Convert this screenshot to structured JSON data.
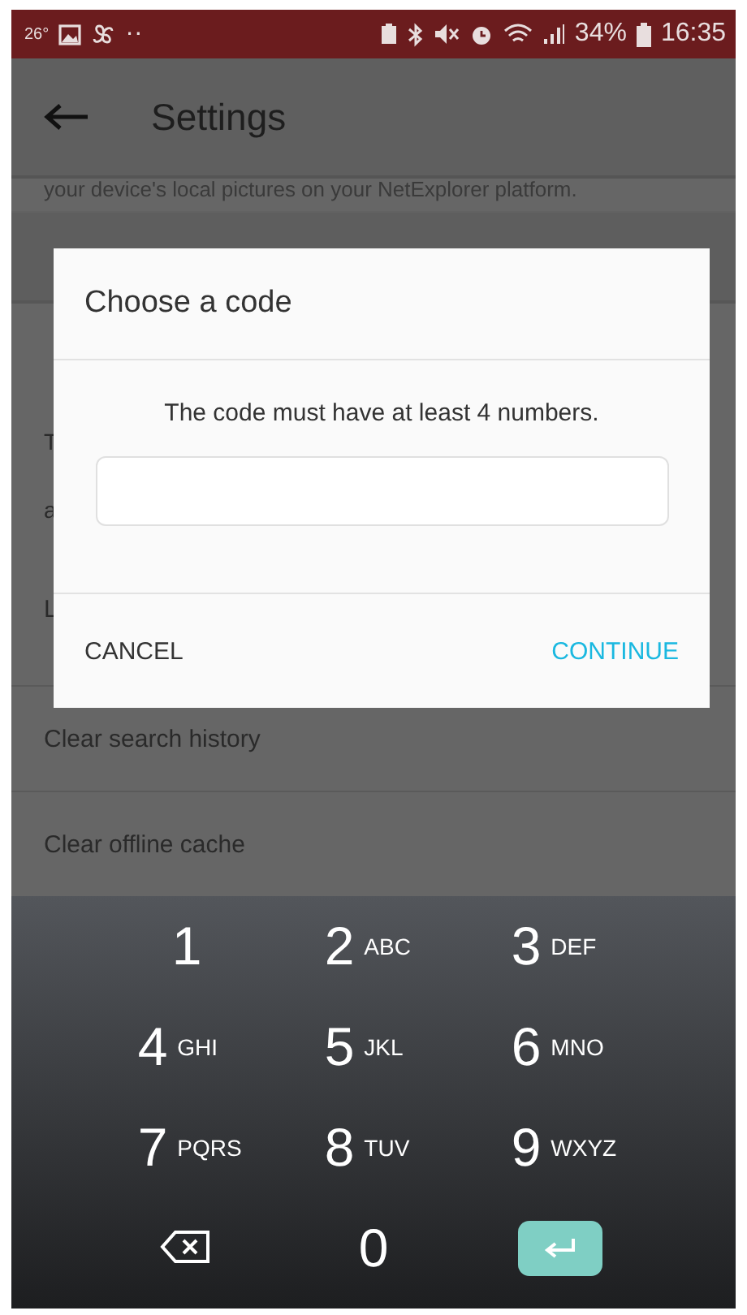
{
  "status_bar": {
    "temperature": "26°",
    "dots": "··",
    "battery_percent": "34%",
    "time": "16:35"
  },
  "app_bar": {
    "title": "Settings"
  },
  "background": {
    "description": "your device's local pictures on your NetExplorer platform.",
    "paragraph_letters": [
      "T",
      "a"
    ],
    "option_letter": "L",
    "items": [
      "Clear search history",
      "Clear offline cache"
    ]
  },
  "dialog": {
    "title": "Choose a code",
    "message": "The code must have at least 4 numbers.",
    "buttons": [
      {
        "label": "CANCEL",
        "kind": "neutral"
      },
      {
        "label": "CONTINUE",
        "kind": "primary"
      }
    ]
  },
  "keypad": {
    "keys": [
      {
        "kind": "digit",
        "digit": "1"
      },
      {
        "kind": "digit",
        "digit": "2",
        "letters": "ABC"
      },
      {
        "kind": "digit",
        "digit": "3",
        "letters": "DEF"
      },
      {
        "kind": "digit",
        "digit": "4",
        "letters": "GHI"
      },
      {
        "kind": "digit",
        "digit": "5",
        "letters": "JKL"
      },
      {
        "kind": "digit",
        "digit": "6",
        "letters": "MNO"
      },
      {
        "kind": "digit",
        "digit": "7",
        "letters": "PQRS"
      },
      {
        "kind": "digit",
        "digit": "8",
        "letters": "TUV"
      },
      {
        "kind": "digit",
        "digit": "9",
        "letters": "WXYZ"
      },
      {
        "kind": "backspace"
      },
      {
        "kind": "digit",
        "digit": "0"
      },
      {
        "kind": "enter"
      }
    ]
  }
}
